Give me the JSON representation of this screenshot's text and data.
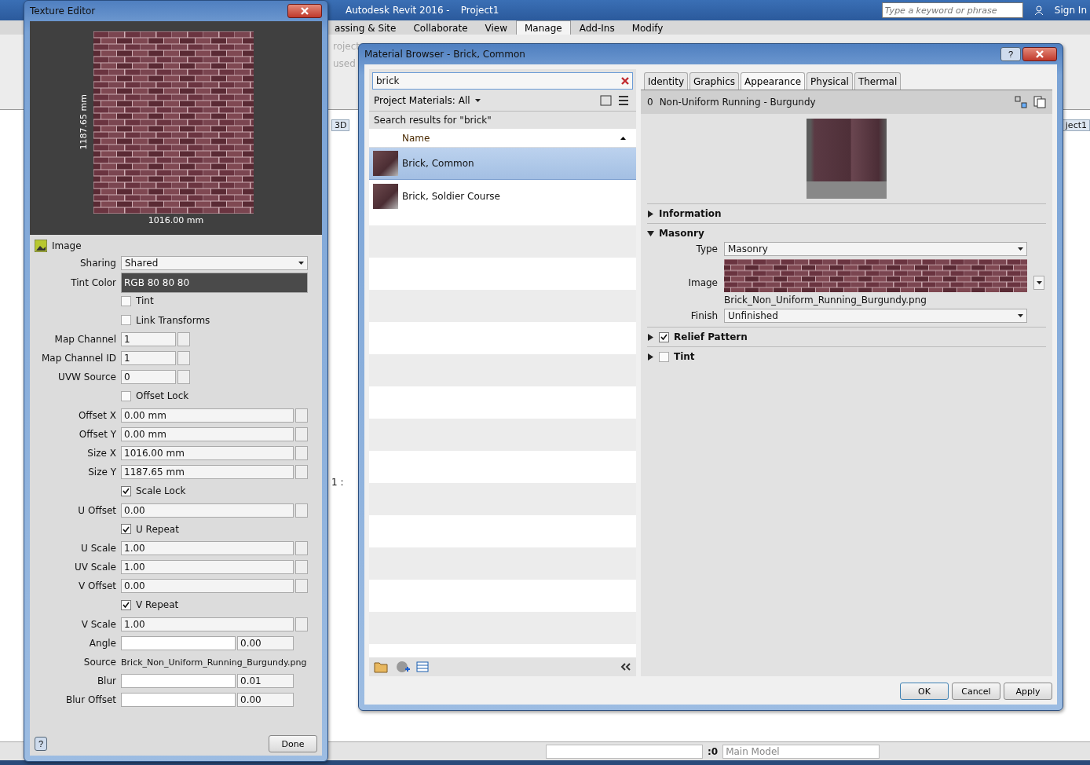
{
  "app": {
    "title": "Autodesk Revit 2016 -",
    "project": "Project1",
    "search": {
      "placeholder": "Type a keyword or phrase"
    },
    "sign_in": "Sign In",
    "ribbon_tabs": [
      {
        "label": "assing & Site",
        "selected": false
      },
      {
        "label": "Collaborate",
        "selected": false
      },
      {
        "label": "View",
        "selected": false
      },
      {
        "label": "Manage",
        "selected": true
      },
      {
        "label": "Add-Ins",
        "selected": false
      },
      {
        "label": "Modify",
        "selected": false
      }
    ],
    "ribbon_fragments": [
      "roject",
      "used"
    ],
    "view_tab": "3D",
    "scale_fragment": "1 :",
    "view_fragment": "ject1"
  },
  "texture_editor": {
    "title": "Texture Editor",
    "height_label": "1187.65 mm",
    "width_label": "1016.00 mm",
    "section": "Image",
    "rows": [
      {
        "kind": "select",
        "label": "Sharing",
        "value": "Shared"
      },
      {
        "kind": "color",
        "label": "Tint Color",
        "value": "RGB 80 80 80"
      },
      {
        "kind": "checkbox",
        "label": "Tint",
        "checked": false
      },
      {
        "kind": "checkbox",
        "label": "Link Transforms",
        "checked": false
      },
      {
        "kind": "short",
        "label": "Map Channel",
        "value": "1"
      },
      {
        "kind": "short",
        "label": "Map Channel ID",
        "value": "1"
      },
      {
        "kind": "short",
        "label": "UVW Source",
        "value": "0"
      },
      {
        "kind": "checkbox",
        "label": "Offset Lock",
        "checked": false
      },
      {
        "kind": "spinner",
        "label": "Offset X",
        "value": "0.00 mm"
      },
      {
        "kind": "spinner",
        "label": "Offset Y",
        "value": "0.00 mm"
      },
      {
        "kind": "spinner",
        "label": "Size X",
        "value": "1016.00 mm"
      },
      {
        "kind": "spinner",
        "label": "Size Y",
        "value": "1187.65 mm"
      },
      {
        "kind": "checkbox",
        "label": "Scale Lock",
        "checked": true
      },
      {
        "kind": "spinner",
        "label": "U Offset",
        "value": "0.00"
      },
      {
        "kind": "checkbox",
        "label": "U Repeat",
        "checked": true
      },
      {
        "kind": "spinner",
        "label": "U Scale",
        "value": "1.00"
      },
      {
        "kind": "spinner",
        "label": "UV Scale",
        "value": "1.00"
      },
      {
        "kind": "spinner",
        "label": "V Offset",
        "value": "0.00"
      },
      {
        "kind": "checkbox",
        "label": "V Repeat",
        "checked": true
      },
      {
        "kind": "spinner",
        "label": "V Scale",
        "value": "1.00"
      },
      {
        "kind": "slider",
        "label": "Angle",
        "value": "0.00"
      },
      {
        "kind": "text",
        "label": "Source",
        "value": "Brick_Non_Uniform_Running_Burgundy.png"
      },
      {
        "kind": "slider",
        "label": "Blur",
        "value": "0.01"
      },
      {
        "kind": "slider",
        "label": "Blur Offset",
        "value": "0.00"
      }
    ],
    "help": "?",
    "done": "Done"
  },
  "material_browser": {
    "title": "Material Browser - Brick, Common",
    "help": "?",
    "search": {
      "value": "brick"
    },
    "library": "Project Materials: All",
    "results_label": "Search results for \"brick\"",
    "column": "Name",
    "materials": [
      {
        "name": "Brick, Common",
        "selected": true
      },
      {
        "name": "Brick, Soldier Course",
        "selected": false
      }
    ],
    "tabs": [
      {
        "label": "Identity",
        "selected": false
      },
      {
        "label": "Graphics",
        "selected": false
      },
      {
        "label": "Appearance",
        "selected": true
      },
      {
        "label": "Physical",
        "selected": false
      },
      {
        "label": "Thermal",
        "selected": false
      }
    ],
    "asset_count": "0",
    "asset_name": "Non-Uniform Running - Burgundy",
    "sections": [
      {
        "title": "Information",
        "expanded": false
      },
      {
        "title": "Masonry",
        "expanded": true,
        "fields": [
          {
            "kind": "select",
            "label": "Type",
            "value": "Masonry"
          },
          {
            "kind": "image",
            "label": "Image",
            "value": "Brick_Non_Uniform_Running_Burgundy.png"
          },
          {
            "kind": "select",
            "label": "Finish",
            "value": "Unfinished"
          }
        ]
      },
      {
        "title": "Relief Pattern",
        "expanded": false,
        "checked": true
      },
      {
        "title": "Tint",
        "expanded": false,
        "checked": false
      }
    ],
    "buttons": [
      "OK",
      "Cancel",
      "Apply"
    ]
  },
  "status_bar": {
    "count": ":0",
    "model": "Main Model"
  }
}
